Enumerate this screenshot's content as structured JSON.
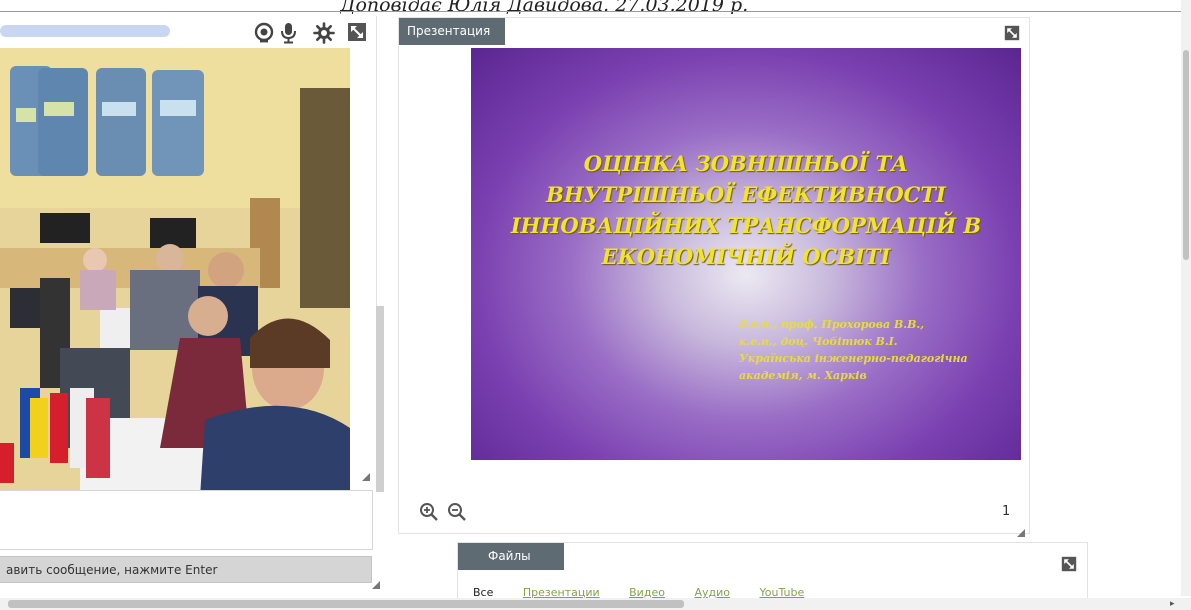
{
  "caption": "Доповідає Юлія Давидова. 27.03.2019 р.",
  "video_panel": {
    "toolbar_icons": [
      "webcam-icon",
      "microphone-icon",
      "settings-gear-icon",
      "expand-icon"
    ],
    "chat_placeholder": "авить сообщение, нажмите Enter"
  },
  "presentation": {
    "tab_label": "Презентация",
    "slide": {
      "title_lines": [
        "ОЦІНКА ЗОВНІШНЬОЇ ТА",
        "ВНУТРІШНЬОЇ ЕФЕКТИВНОСТІ",
        "ІННОВАЦІЙНИХ ТРАНСФОРМАЦІЙ В",
        "ЕКОНОМІЧНІЙ ОСВІТІ"
      ],
      "authors_lines": [
        "д.е.н., проф. Прохорова В.В.,",
        "к.е.н., доц. Чобітюк В.І.",
        "Українська інженерно-педагогічна",
        "академія, м. Харків"
      ]
    },
    "page_number": "1",
    "zoom_controls": [
      "zoom-in-icon",
      "zoom-out-icon"
    ]
  },
  "files": {
    "tab_label": "Файлы",
    "filters": [
      {
        "label": "Все",
        "active": true
      },
      {
        "label": "Презентации",
        "active": false
      },
      {
        "label": "Видео",
        "active": false
      },
      {
        "label": "Аудио",
        "active": false
      },
      {
        "label": "YouTube",
        "active": false
      }
    ]
  },
  "colors": {
    "tab_bg": "#5f6b73",
    "slide_text": "#f3e42a",
    "slide_purple": "#7a3fb0",
    "filter_link": "#7fa34a"
  }
}
